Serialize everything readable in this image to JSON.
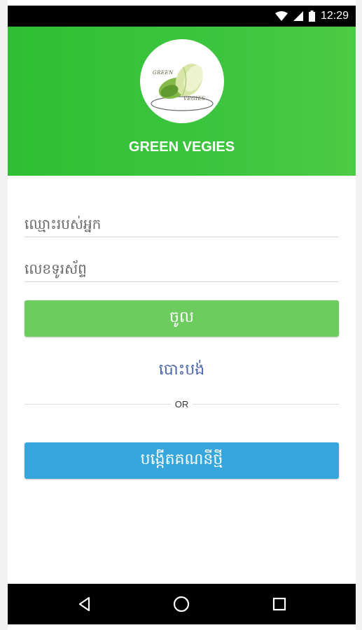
{
  "status_bar": {
    "time": "12:29",
    "icons": [
      "wifi-icon",
      "signal-icon",
      "battery-icon"
    ]
  },
  "header": {
    "logo_text_top": "GREEN",
    "logo_text_bottom": "VEGIES",
    "app_title": "GREEN VEGIES",
    "color": "#3cc53e"
  },
  "form": {
    "username_placeholder": "ឈ្មោះរបស់អ្នក",
    "phone_placeholder": "លេខទូរស័ព្ទ",
    "login_label": "ចូល",
    "forgot_label": "បោះបង់",
    "or_label": "OR",
    "register_label": "បង្កើតគណនីថ្មី"
  },
  "colors": {
    "login_button": "#6ccc5d",
    "register_button": "#36a6dc",
    "link": "#4a64a8"
  },
  "nav_bar": {
    "icons": [
      "back-icon",
      "home-icon",
      "recents-icon"
    ]
  }
}
